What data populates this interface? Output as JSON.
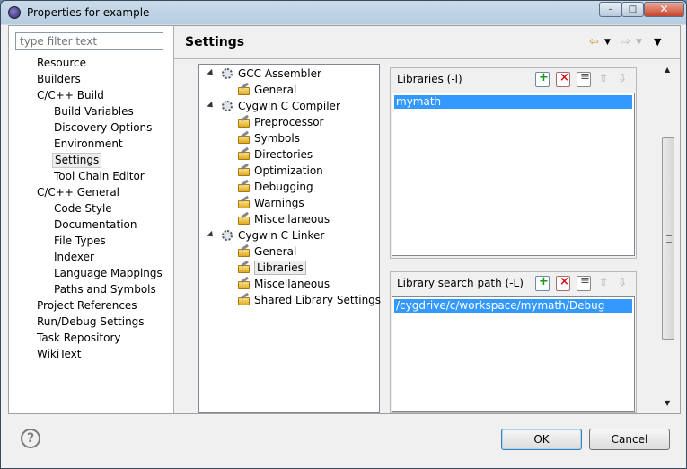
{
  "window": {
    "title": "Properties for example",
    "minimize": "–",
    "maximize": "□",
    "close": "✕"
  },
  "filter": {
    "placeholder": "type filter text"
  },
  "nav": [
    {
      "label": "Resource",
      "level": 0
    },
    {
      "label": "Builders",
      "level": 0
    },
    {
      "label": "C/C++ Build",
      "level": 0
    },
    {
      "label": "Build Variables",
      "level": 1
    },
    {
      "label": "Discovery Options",
      "level": 1
    },
    {
      "label": "Environment",
      "level": 1
    },
    {
      "label": "Settings",
      "level": 1,
      "selected": true
    },
    {
      "label": "Tool Chain Editor",
      "level": 1
    },
    {
      "label": "C/C++ General",
      "level": 0
    },
    {
      "label": "Code Style",
      "level": 1
    },
    {
      "label": "Documentation",
      "level": 1
    },
    {
      "label": "File Types",
      "level": 1
    },
    {
      "label": "Indexer",
      "level": 1
    },
    {
      "label": "Language Mappings",
      "level": 1
    },
    {
      "label": "Paths and Symbols",
      "level": 1
    },
    {
      "label": "Project References",
      "level": 0
    },
    {
      "label": "Run/Debug Settings",
      "level": 0
    },
    {
      "label": "Task Repository",
      "level": 0
    },
    {
      "label": "WikiText",
      "level": 0
    }
  ],
  "page": {
    "title": "Settings"
  },
  "tools": [
    {
      "label": "GCC Assembler",
      "kind": "tool"
    },
    {
      "label": "General",
      "kind": "option"
    },
    {
      "label": "Cygwin C Compiler",
      "kind": "tool"
    },
    {
      "label": "Preprocessor",
      "kind": "option"
    },
    {
      "label": "Symbols",
      "kind": "option"
    },
    {
      "label": "Directories",
      "kind": "option"
    },
    {
      "label": "Optimization",
      "kind": "option"
    },
    {
      "label": "Debugging",
      "kind": "option"
    },
    {
      "label": "Warnings",
      "kind": "option"
    },
    {
      "label": "Miscellaneous",
      "kind": "option"
    },
    {
      "label": "Cygwin C Linker",
      "kind": "tool"
    },
    {
      "label": "General",
      "kind": "option"
    },
    {
      "label": "Libraries",
      "kind": "option",
      "selected": true
    },
    {
      "label": "Miscellaneous",
      "kind": "option"
    },
    {
      "label": "Shared Library Settings",
      "kind": "option"
    }
  ],
  "libraries": {
    "title": "Libraries (-l)",
    "items": [
      "mymath"
    ]
  },
  "library_paths": {
    "title": "Library search path (-L)",
    "items": [
      "/cygdrive/c/workspace/mymath/Debug"
    ]
  },
  "buttons": {
    "ok": "OK",
    "cancel": "Cancel",
    "help": "?"
  },
  "icons": {
    "nav_back": "back-arrow-icon",
    "nav_forward": "forward-arrow-icon",
    "view_menu": "view-menu-icon"
  }
}
